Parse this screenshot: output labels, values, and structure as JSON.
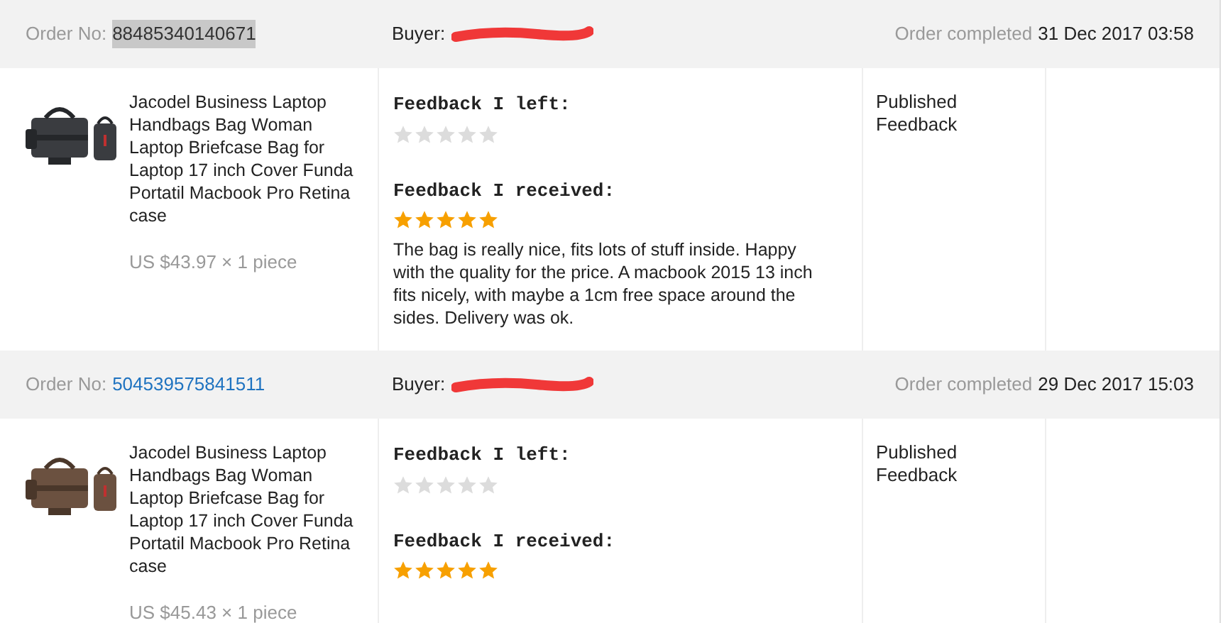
{
  "orders": [
    {
      "order_label": "Order No:",
      "order_number": "88485340140671",
      "number_highlighted": true,
      "buyer_label": "Buyer:",
      "status_label": "Order completed",
      "date": "31 Dec 2017 03:58",
      "product_title": "Jacodel Business Laptop Handbags Bag Woman Laptop Briefcase Bag for Laptop 17 inch Cover Funda Portatil Macbook Pro Retina case",
      "price": "US $43.97 × 1 piece",
      "left_heading": "Feedback I left:",
      "left_rating": {
        "stars": 0
      },
      "received_heading": "Feedback I received:",
      "received_rating": {
        "stars": 5
      },
      "comment": "The bag is really nice, fits lots of stuff inside. Happy with the quality for the price. A macbook 2015 13 inch fits nicely, with maybe a 1cm free space around the sides. Delivery was ok.",
      "feedback_status": "Published Feedback"
    },
    {
      "order_label": "Order No:",
      "order_number": "504539575841511",
      "number_highlighted": false,
      "buyer_label": "Buyer:",
      "status_label": "Order completed",
      "date": "29 Dec 2017 15:03",
      "product_title": "Jacodel Business Laptop Handbags Bag Woman Laptop Briefcase Bag for Laptop 17 inch Cover Funda Portatil Macbook Pro Retina case",
      "price": "US $45.43 × 1 piece",
      "left_heading": "Feedback I left:",
      "left_rating": {
        "stars": 0
      },
      "received_heading": "Feedback I received:",
      "received_rating": {
        "stars": 5
      },
      "feedback_status": "Published Feedback"
    }
  ]
}
